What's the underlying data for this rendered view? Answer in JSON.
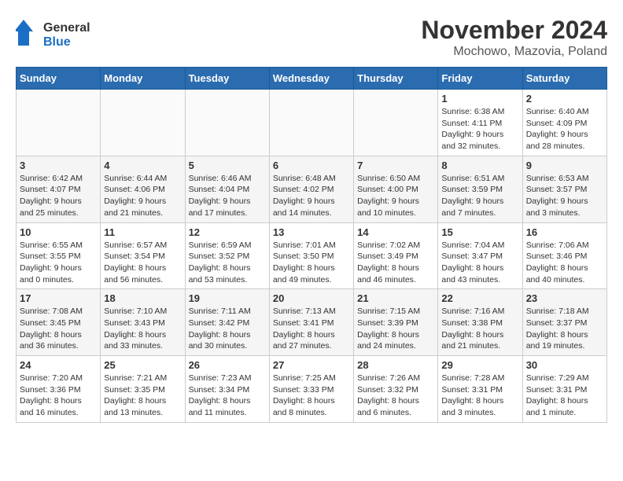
{
  "header": {
    "logo_line1": "General",
    "logo_line2": "Blue",
    "month": "November 2024",
    "location": "Mochowo, Mazovia, Poland"
  },
  "weekdays": [
    "Sunday",
    "Monday",
    "Tuesday",
    "Wednesday",
    "Thursday",
    "Friday",
    "Saturday"
  ],
  "weeks": [
    [
      {
        "day": "",
        "info": ""
      },
      {
        "day": "",
        "info": ""
      },
      {
        "day": "",
        "info": ""
      },
      {
        "day": "",
        "info": ""
      },
      {
        "day": "",
        "info": ""
      },
      {
        "day": "1",
        "info": "Sunrise: 6:38 AM\nSunset: 4:11 PM\nDaylight: 9 hours\nand 32 minutes."
      },
      {
        "day": "2",
        "info": "Sunrise: 6:40 AM\nSunset: 4:09 PM\nDaylight: 9 hours\nand 28 minutes."
      }
    ],
    [
      {
        "day": "3",
        "info": "Sunrise: 6:42 AM\nSunset: 4:07 PM\nDaylight: 9 hours\nand 25 minutes."
      },
      {
        "day": "4",
        "info": "Sunrise: 6:44 AM\nSunset: 4:06 PM\nDaylight: 9 hours\nand 21 minutes."
      },
      {
        "day": "5",
        "info": "Sunrise: 6:46 AM\nSunset: 4:04 PM\nDaylight: 9 hours\nand 17 minutes."
      },
      {
        "day": "6",
        "info": "Sunrise: 6:48 AM\nSunset: 4:02 PM\nDaylight: 9 hours\nand 14 minutes."
      },
      {
        "day": "7",
        "info": "Sunrise: 6:50 AM\nSunset: 4:00 PM\nDaylight: 9 hours\nand 10 minutes."
      },
      {
        "day": "8",
        "info": "Sunrise: 6:51 AM\nSunset: 3:59 PM\nDaylight: 9 hours\nand 7 minutes."
      },
      {
        "day": "9",
        "info": "Sunrise: 6:53 AM\nSunset: 3:57 PM\nDaylight: 9 hours\nand 3 minutes."
      }
    ],
    [
      {
        "day": "10",
        "info": "Sunrise: 6:55 AM\nSunset: 3:55 PM\nDaylight: 9 hours\nand 0 minutes."
      },
      {
        "day": "11",
        "info": "Sunrise: 6:57 AM\nSunset: 3:54 PM\nDaylight: 8 hours\nand 56 minutes."
      },
      {
        "day": "12",
        "info": "Sunrise: 6:59 AM\nSunset: 3:52 PM\nDaylight: 8 hours\nand 53 minutes."
      },
      {
        "day": "13",
        "info": "Sunrise: 7:01 AM\nSunset: 3:50 PM\nDaylight: 8 hours\nand 49 minutes."
      },
      {
        "day": "14",
        "info": "Sunrise: 7:02 AM\nSunset: 3:49 PM\nDaylight: 8 hours\nand 46 minutes."
      },
      {
        "day": "15",
        "info": "Sunrise: 7:04 AM\nSunset: 3:47 PM\nDaylight: 8 hours\nand 43 minutes."
      },
      {
        "day": "16",
        "info": "Sunrise: 7:06 AM\nSunset: 3:46 PM\nDaylight: 8 hours\nand 40 minutes."
      }
    ],
    [
      {
        "day": "17",
        "info": "Sunrise: 7:08 AM\nSunset: 3:45 PM\nDaylight: 8 hours\nand 36 minutes."
      },
      {
        "day": "18",
        "info": "Sunrise: 7:10 AM\nSunset: 3:43 PM\nDaylight: 8 hours\nand 33 minutes."
      },
      {
        "day": "19",
        "info": "Sunrise: 7:11 AM\nSunset: 3:42 PM\nDaylight: 8 hours\nand 30 minutes."
      },
      {
        "day": "20",
        "info": "Sunrise: 7:13 AM\nSunset: 3:41 PM\nDaylight: 8 hours\nand 27 minutes."
      },
      {
        "day": "21",
        "info": "Sunrise: 7:15 AM\nSunset: 3:39 PM\nDaylight: 8 hours\nand 24 minutes."
      },
      {
        "day": "22",
        "info": "Sunrise: 7:16 AM\nSunset: 3:38 PM\nDaylight: 8 hours\nand 21 minutes."
      },
      {
        "day": "23",
        "info": "Sunrise: 7:18 AM\nSunset: 3:37 PM\nDaylight: 8 hours\nand 19 minutes."
      }
    ],
    [
      {
        "day": "24",
        "info": "Sunrise: 7:20 AM\nSunset: 3:36 PM\nDaylight: 8 hours\nand 16 minutes."
      },
      {
        "day": "25",
        "info": "Sunrise: 7:21 AM\nSunset: 3:35 PM\nDaylight: 8 hours\nand 13 minutes."
      },
      {
        "day": "26",
        "info": "Sunrise: 7:23 AM\nSunset: 3:34 PM\nDaylight: 8 hours\nand 11 minutes."
      },
      {
        "day": "27",
        "info": "Sunrise: 7:25 AM\nSunset: 3:33 PM\nDaylight: 8 hours\nand 8 minutes."
      },
      {
        "day": "28",
        "info": "Sunrise: 7:26 AM\nSunset: 3:32 PM\nDaylight: 8 hours\nand 6 minutes."
      },
      {
        "day": "29",
        "info": "Sunrise: 7:28 AM\nSunset: 3:31 PM\nDaylight: 8 hours\nand 3 minutes."
      },
      {
        "day": "30",
        "info": "Sunrise: 7:29 AM\nSunset: 3:31 PM\nDaylight: 8 hours\nand 1 minute."
      }
    ]
  ]
}
